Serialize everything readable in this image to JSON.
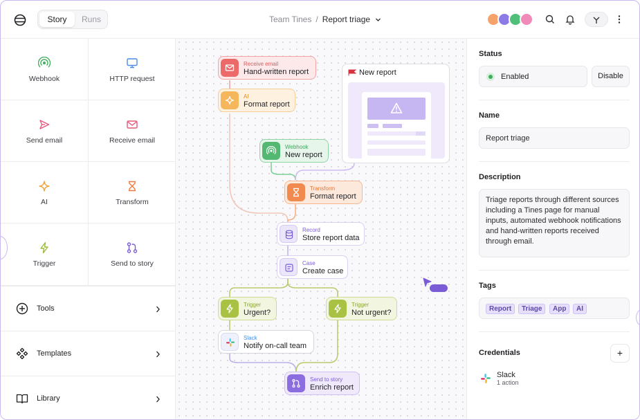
{
  "topbar": {
    "tabs": [
      {
        "label": "Story",
        "active": true
      },
      {
        "label": "Runs",
        "active": false
      }
    ],
    "breadcrumb": {
      "team": "Team Tines",
      "separator": "/",
      "story": "Report triage"
    },
    "avatar_colors": [
      "#f5a26b",
      "#8c7be6",
      "#4fbf7a",
      "#f08ab8"
    ],
    "icons": [
      "search-icon",
      "bell-icon",
      "user-icon",
      "more-vertical-icon"
    ]
  },
  "toolbox": {
    "tiles": [
      {
        "label": "Webhook",
        "icon": "webhook-icon",
        "color": "#3fae5b"
      },
      {
        "label": "HTTP request",
        "icon": "monitor-icon",
        "color": "#4a8be6"
      },
      {
        "label": "Send email",
        "icon": "send-icon",
        "color": "#e8557a"
      },
      {
        "label": "Receive email",
        "icon": "mail-icon",
        "color": "#e8557a"
      },
      {
        "label": "AI",
        "icon": "sparkle-icon",
        "color": "#f0a23c"
      },
      {
        "label": "Transform",
        "icon": "hourglass-icon",
        "color": "#f07a3c"
      },
      {
        "label": "Trigger",
        "icon": "bolt-icon",
        "color": "#9bbd3a"
      },
      {
        "label": "Send to story",
        "icon": "branch-icon",
        "color": "#7a5cd6"
      }
    ],
    "nav": [
      {
        "label": "Tools",
        "icon": "plus-circle-icon"
      },
      {
        "label": "Templates",
        "icon": "diamonds-icon"
      },
      {
        "label": "Library",
        "icon": "book-icon"
      }
    ]
  },
  "canvas": {
    "nodes": {
      "receive_email": {
        "type": "Receive email",
        "name": "Hand-written report"
      },
      "ai": {
        "type": "AI",
        "name": "Format report"
      },
      "webhook": {
        "type": "Webhook",
        "name": "New report"
      },
      "transform": {
        "type": "Transform",
        "name": "Format report"
      },
      "record": {
        "type": "Record",
        "name": "Store report data"
      },
      "case": {
        "type": "Case",
        "name": "Create case"
      },
      "trigger_urgent": {
        "type": "Trigger",
        "name": "Urgent?"
      },
      "trigger_not_urgent": {
        "type": "Trigger",
        "name": "Not urgent?"
      },
      "slack": {
        "type": "Slack",
        "name": "Notify on-call team"
      },
      "send_to_story": {
        "type": "Send to story",
        "name": "Enrich report"
      }
    },
    "page": {
      "title": "New report",
      "icon": "flag-icon"
    }
  },
  "details": {
    "status": {
      "title": "Status",
      "value": "Enabled",
      "action": "Disable"
    },
    "name": {
      "title": "Name",
      "value": "Report triage"
    },
    "description": {
      "title": "Description",
      "value": "Triage reports through different sources including a Tines page for manual inputs, automated webhook notifications and hand-written reports received through email."
    },
    "tags": {
      "title": "Tags",
      "items": [
        "Report",
        "Triage",
        "App",
        "AI"
      ]
    },
    "credentials": {
      "title": "Credentials",
      "add_label": "+",
      "items": [
        {
          "name": "Slack",
          "count": "1 action"
        }
      ]
    }
  }
}
